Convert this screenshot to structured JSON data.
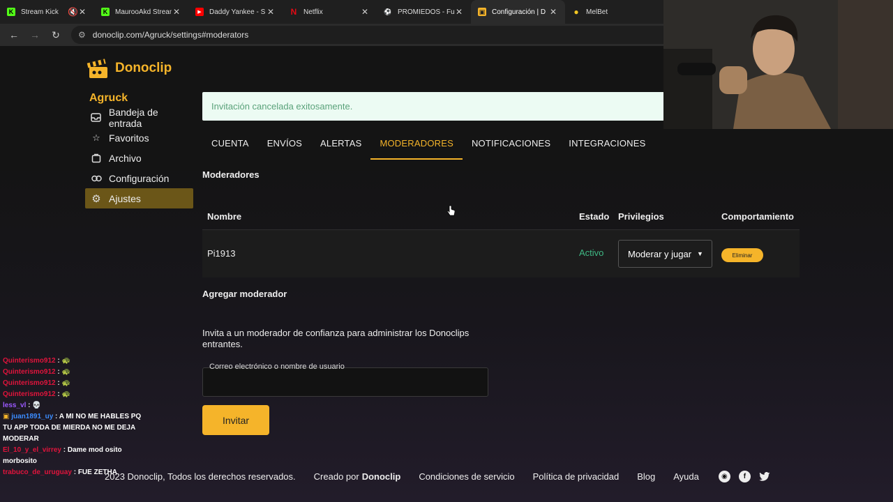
{
  "browser": {
    "tabs": [
      {
        "title": "Stream Kick",
        "fav_color": "#53fc18",
        "fav_glyph": "K",
        "active": false,
        "muted": true
      },
      {
        "title": "MaurooAkd Stream",
        "fav_color": "#53fc18",
        "fav_glyph": "K",
        "active": false
      },
      {
        "title": "Daddy Yankee - S",
        "fav_color": "#ff0000",
        "fav_glyph": "▶",
        "active": false
      },
      {
        "title": "Netflix",
        "fav_color": "#e50914",
        "fav_glyph": "N",
        "active": false
      },
      {
        "title": "PROMIEDOS - Fut",
        "fav_color": "#2ea043",
        "fav_glyph": "⚽",
        "active": false
      },
      {
        "title": "Configuración | D",
        "fav_color": "#f5b42a",
        "fav_glyph": "▣",
        "active": true
      },
      {
        "title": "MelBet",
        "fav_color": "#f3c623",
        "fav_glyph": "●",
        "active": false
      }
    ],
    "url": "donoclip.com/Agruck/settings#moderators"
  },
  "brand": {
    "name": "Donoclip",
    "color": "#f5b42a"
  },
  "user": {
    "name": "Agruck"
  },
  "sidebar": {
    "items": [
      {
        "label": "Bandeja de entrada",
        "icon": "inbox-icon"
      },
      {
        "label": "Favoritos",
        "icon": "star-icon"
      },
      {
        "label": "Archivo",
        "icon": "archive-icon"
      },
      {
        "label": "Configuración",
        "icon": "link-icon"
      },
      {
        "label": "Ajustes",
        "icon": "gear-icon",
        "active": true
      }
    ]
  },
  "alert": {
    "message": "Invitación cancelada exitosamente."
  },
  "settings_tabs": [
    {
      "label": "CUENTA"
    },
    {
      "label": "ENVÍOS"
    },
    {
      "label": "ALERTAS"
    },
    {
      "label": "MODERADORES",
      "active": true
    },
    {
      "label": "NOTIFICACIONES"
    },
    {
      "label": "INTEGRACIONES"
    }
  ],
  "moderators": {
    "heading": "Moderadores",
    "columns": {
      "name": "Nombre",
      "status": "Estado",
      "privileges": "Privilegios",
      "behavior": "Comportamiento"
    },
    "rows": [
      {
        "name": "Pi1913",
        "status": "Activo",
        "privilege": "Moderar y jugar",
        "action": "Eliminar"
      }
    ]
  },
  "add_moderator": {
    "heading": "Agregar moderador",
    "description": "Invita a un moderador de confianza para administrar los Donoclips entrantes.",
    "field_label": "Correo electrónico o nombre de usuario",
    "field_value": "",
    "button": "Invitar"
  },
  "footer": {
    "copyright": "2023 Donoclip, Todos los derechos reservados.",
    "created_by_prefix": "Creado por",
    "created_by_name": "Donoclip",
    "links": [
      "Condiciones de servicio",
      "Política de privacidad",
      "Blog",
      "Ayuda"
    ],
    "social": [
      "discord-icon",
      "facebook-icon",
      "twitter-icon"
    ]
  },
  "chat": {
    "messages": [
      {
        "user": "Quinterismo912",
        "color": "#e0143c",
        "text": ""
      },
      {
        "user": "Quinterismo912",
        "color": "#e0143c",
        "text": ""
      },
      {
        "user": "Quinterismo912",
        "color": "#e0143c",
        "text": ""
      },
      {
        "user": "Quinterismo912",
        "color": "#e0143c",
        "text": ""
      },
      {
        "user": "less_vl",
        "color": "#9b59ff",
        "text": ""
      },
      {
        "user": "juan1891_uy",
        "color": "#3b8cff",
        "text": "A MI NO ME HABLES PQ TU APP TODA DE MIERDA NO ME DEJA MODERAR"
      },
      {
        "user": "El_10_y_el_virrey",
        "color": "#e0143c",
        "text": "Dame mod osito morbosito"
      },
      {
        "user": "trabuco_de_uruguay",
        "color": "#e0143c",
        "text": "FUE ZETHA"
      }
    ]
  }
}
